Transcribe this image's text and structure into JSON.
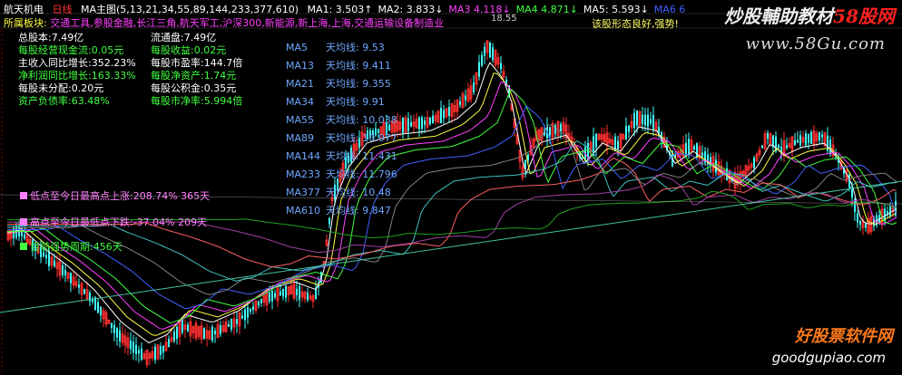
{
  "header": {
    "stock_name": "航天机电",
    "period": "日线",
    "indicator": "MA主图(5,13,21,34,55,89,144,233,377,610)",
    "ma_readings": [
      {
        "label": "MA1:",
        "value": "3.503",
        "arrow": "↑",
        "color": "#ffffff"
      },
      {
        "label": "MA2:",
        "value": "3.833",
        "arrow": "↓",
        "color": "#ffffff"
      },
      {
        "label": "MA3",
        "value": "4.118",
        "arrow": "↓",
        "color": "#ff40ff"
      },
      {
        "label": "MA4",
        "value": "4.871",
        "arrow": "↓",
        "color": "#40ff40"
      },
      {
        "label": "MA5:",
        "value": "5.593",
        "arrow": "↓",
        "color": "#ffffff"
      },
      {
        "label": "MA6",
        "value": "6",
        "arrow": "",
        "color": "#4060ff"
      }
    ]
  },
  "sector": {
    "label": "所属板块:",
    "items": "交通工具,参股金融,长江三角,航天军工,沪深300,新能源,新上海,上海,交通运输设备制造业"
  },
  "price_marker": "18.55",
  "pattern_note": "该股形态良好,强势!",
  "fundamentals_left": [
    {
      "label": "总股本:",
      "value": "7.49亿",
      "color": "#ffffff"
    },
    {
      "label": "每股经营现金流:",
      "value": "0.05元",
      "color": "#40ff40"
    },
    {
      "label": "主收入同比增长:",
      "value": "352.23%",
      "color": "#ffffff"
    },
    {
      "label": "净利润同比增长:",
      "value": "163.33%",
      "color": "#40ff40"
    },
    {
      "label": "每股未分配:",
      "value": "0.20元",
      "color": "#ffffff"
    },
    {
      "label": "资产负债率:",
      "value": "63.48%",
      "color": "#40ff40"
    }
  ],
  "fundamentals_right": [
    {
      "label": "流通盘:",
      "value": "7.49亿",
      "color": "#ffffff"
    },
    {
      "label": "每股收益:",
      "value": "0.02元",
      "color": "#40ff40"
    },
    {
      "label": "每股市盈率:",
      "value": "144.7倍",
      "color": "#ffffff"
    },
    {
      "label": "每股净资产:",
      "value": "1.74元",
      "color": "#40ff40"
    },
    {
      "label": "每股公积金:",
      "value": "0.35元",
      "color": "#ffffff"
    },
    {
      "label": "每股市净率:",
      "value": "5.994倍",
      "color": "#40ff40"
    }
  ],
  "ma_days": [
    {
      "name": "MA5",
      "label": "天均线:",
      "value": "9.53"
    },
    {
      "name": "MA13",
      "label": "天均线:",
      "value": "9.411"
    },
    {
      "name": "MA21",
      "label": "天均线:",
      "value": "9.355"
    },
    {
      "name": "MA34",
      "label": "天均线:",
      "value": "9.91"
    },
    {
      "name": "MA55",
      "label": "天均线:",
      "value": "10.038"
    },
    {
      "name": "MA89",
      "label": "天均线:",
      "value": "10.977"
    },
    {
      "name": "MA144",
      "label": "天均线:",
      "value": "11.431"
    },
    {
      "name": "MA233",
      "label": "天均线:",
      "value": "11.796"
    },
    {
      "name": "MA377",
      "label": "天均线:",
      "value": "10.48"
    },
    {
      "name": "MA610",
      "label": "天均线:",
      "value": "9.847"
    }
  ],
  "stats": [
    {
      "text": "低点至今日最高点上涨:208.74%",
      "days": "365天",
      "color": "#ff80ff",
      "square": "#ff80ff"
    },
    {
      "text": "高点至今日最低点下跌:-37.04%",
      "days": "209天",
      "color": "#ff80ff",
      "square": "#ff80ff"
    },
    {
      "text": "目前强势周期:456天",
      "days": "",
      "color": "#40ff40",
      "square": "#40ff40"
    }
  ],
  "watermarks": {
    "top_cn": "炒股輔助教材",
    "top_brand": "58股网",
    "top_url": "www.58Gu.com",
    "bottom_cn": "好股票软件网",
    "bottom_url": "goodgupiao.com"
  }
}
